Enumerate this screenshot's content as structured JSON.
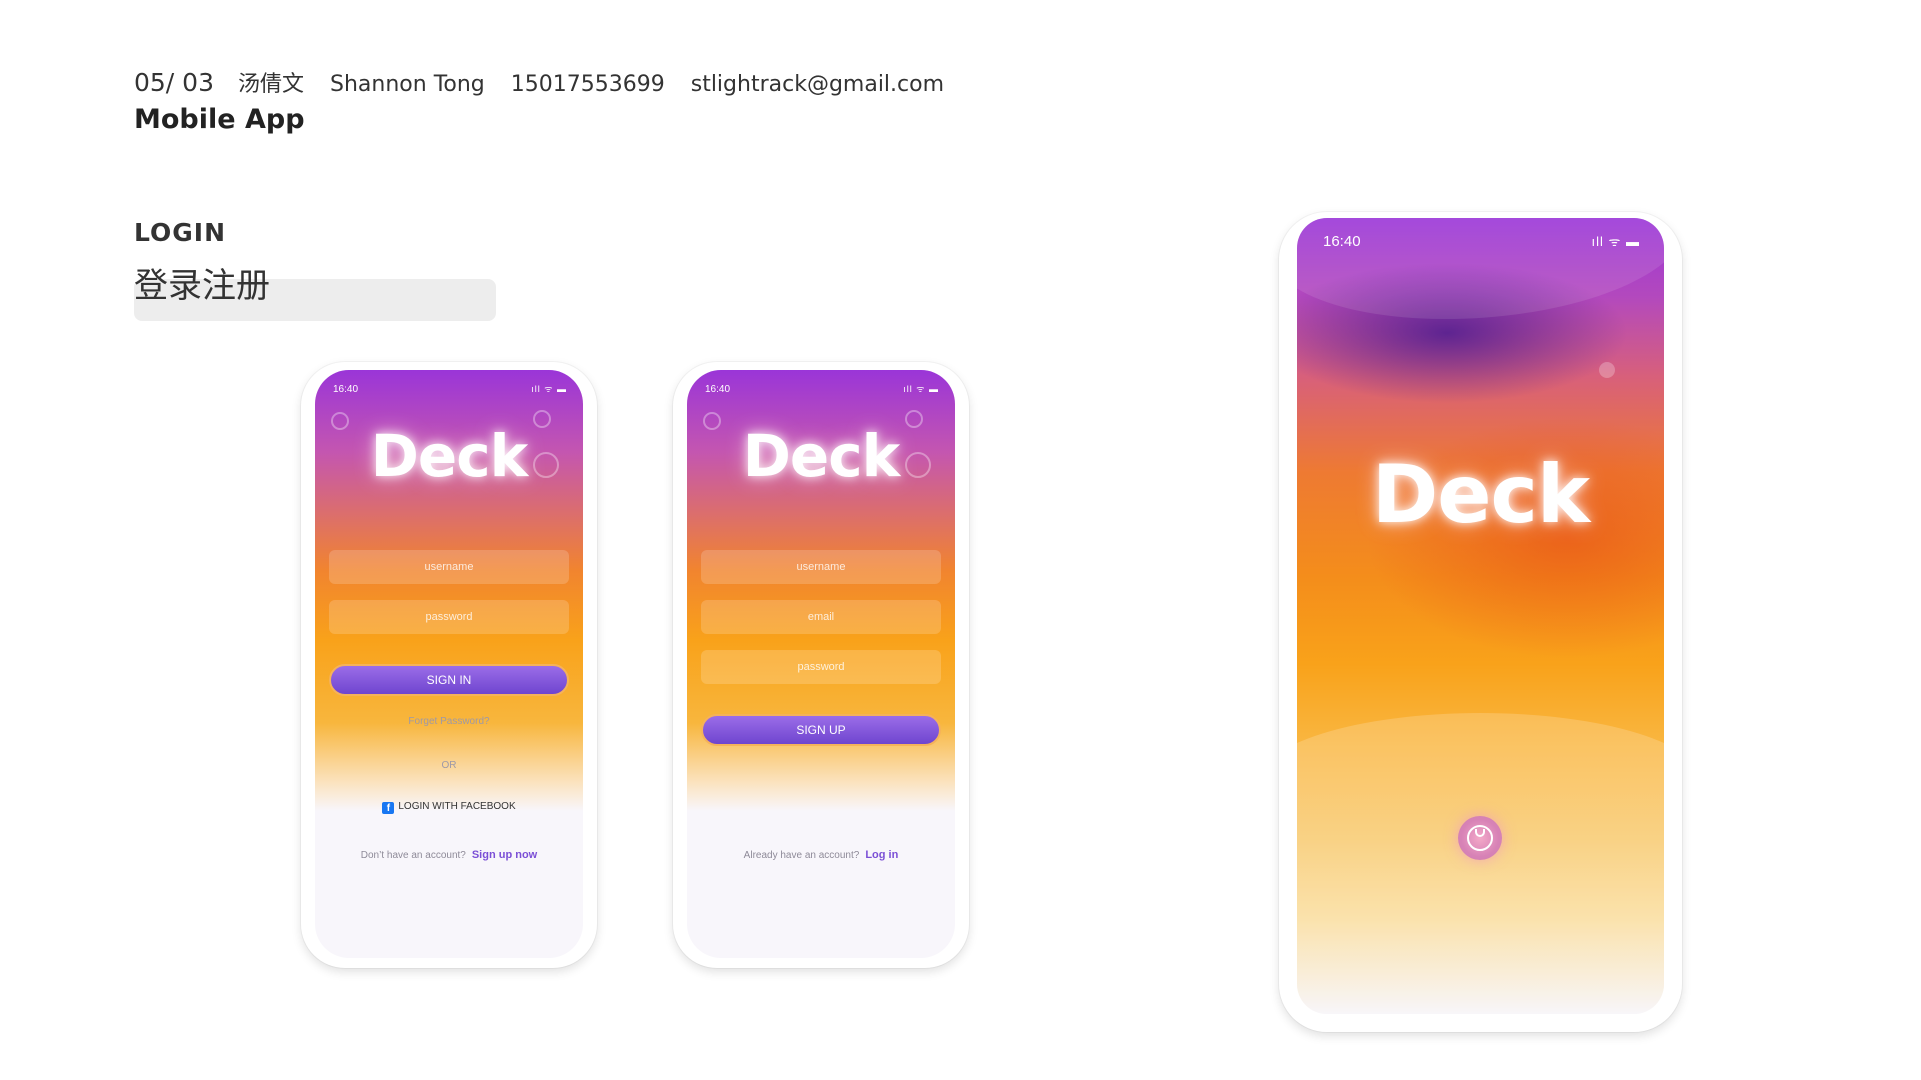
{
  "header": {
    "page_number": "05/ 03",
    "name_cn": "汤倩文",
    "name_en": "Shannon Tong",
    "phone": "15017553699",
    "email": "stlightrack@gmail.com",
    "title": "Mobile App"
  },
  "section": {
    "title": "LOGIN",
    "subtitle_cn": "登录注册"
  },
  "status_bar": {
    "time": "16:40",
    "icons": "ıll ᯤ ▬"
  },
  "brand": {
    "logo_text": "Deck"
  },
  "login_screen": {
    "username_placeholder": "username",
    "password_placeholder": "password",
    "sign_in_label": "SIGN IN",
    "forgot_password": "Forget Password?",
    "or_divider": "OR",
    "facebook_label": "LOGIN WITH FACEBOOK",
    "no_account_text": "Don’t have an account?",
    "sign_up_link": "Sign up now"
  },
  "signup_screen": {
    "username_placeholder": "username",
    "email_placeholder": "email",
    "password_placeholder": "password",
    "sign_up_label": "SIGN UP",
    "have_account_text": "Already have an account?",
    "log_in_link": "Log in"
  },
  "colors": {
    "accent_purple": "#7b4fd6",
    "gradient_top": "#9a35d8",
    "gradient_orange": "#f9a21a"
  }
}
